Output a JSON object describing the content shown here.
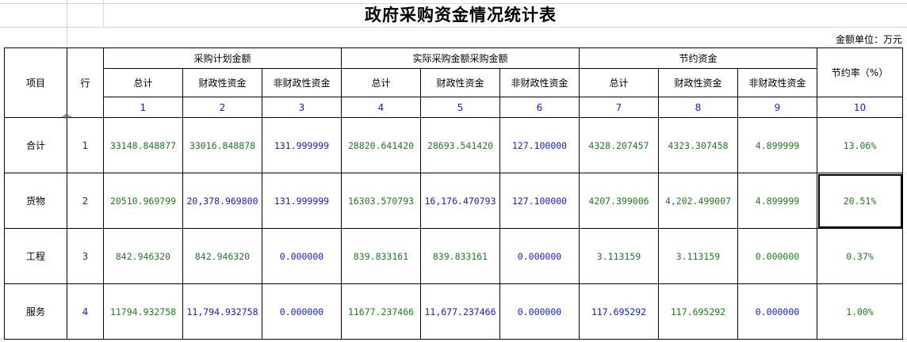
{
  "title": "政府采购资金情况统计表",
  "unit_label": "金额单位：万元",
  "headers": {
    "item": "项目",
    "line": "行",
    "groups": [
      "采购计划金额",
      "实际采购金额采购金额",
      "节约资金"
    ],
    "rate": "节约率（%）",
    "sub": [
      "总计",
      "财政性资金",
      "非财政性资金",
      "总计",
      "财政性资金",
      "非财政性资金",
      "总计",
      "财政性资金",
      "非财政性资金"
    ],
    "col_numbers": [
      "1",
      "2",
      "3",
      "4",
      "5",
      "6",
      "7",
      "8",
      "9",
      "10"
    ]
  },
  "rows": [
    {
      "item": "合计",
      "line": "1",
      "values": [
        "33148.848877",
        "33016.848878",
        "131.999999",
        "28820.641420",
        "28693.541420",
        "127.100000",
        "4328.207457",
        "4323.307458",
        "4.899999",
        "13.06%"
      ]
    },
    {
      "item": "货物",
      "line": "2",
      "values": [
        "20510.969799",
        "20,378.969800",
        "131.999999",
        "16303.570793",
        "16,176.470793",
        "127.100000",
        "4207.399006",
        "4,202.499007",
        "4.899999",
        "20.51%"
      ]
    },
    {
      "item": "工程",
      "line": "3",
      "values": [
        "842.946320",
        "842.946320",
        "0.000000",
        "839.833161",
        "839.833161",
        "0.000000",
        "3.113159",
        "3.113159",
        "0.000000",
        "0.37%"
      ]
    },
    {
      "item": "服务",
      "line": "4",
      "values": [
        "11794.932758",
        "11,794.932758",
        "0.000000",
        "11677.237466",
        "11,677.237466",
        "0.000000",
        "117.695292",
        "117.695292",
        "0.000000",
        "1.00%"
      ]
    }
  ],
  "colors": {
    "text": "#000000",
    "number_green": "#1e7a1e",
    "number_blue": "#1a1acc",
    "gridline": "#d4d4d4"
  },
  "selected_cell": {
    "row": 2,
    "column": "rate"
  }
}
